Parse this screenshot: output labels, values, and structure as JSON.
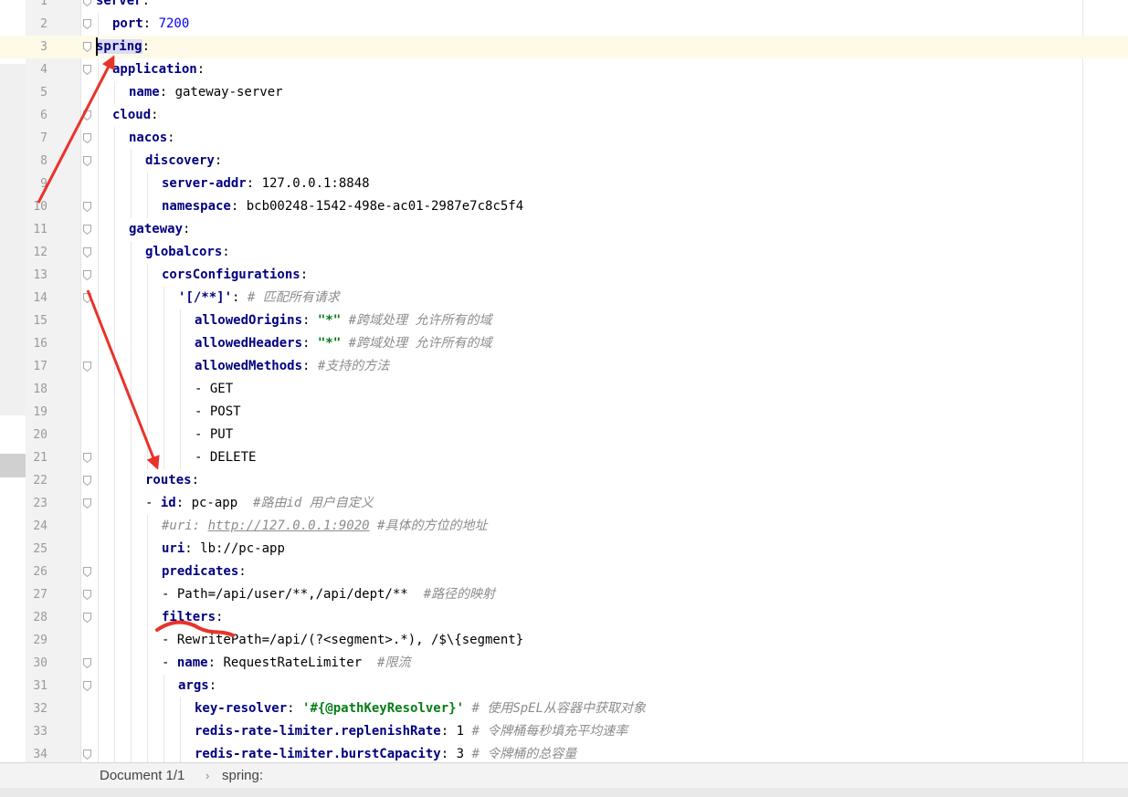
{
  "editor": {
    "current_line": 3,
    "lines": [
      {
        "n": 1,
        "fold": true,
        "indent": 0,
        "segs": [
          {
            "t": "server",
            "c": "k"
          },
          {
            "t": ":",
            "c": "p"
          }
        ]
      },
      {
        "n": 2,
        "fold": true,
        "indent": 1,
        "segs": [
          {
            "t": "port",
            "c": "k"
          },
          {
            "t": ": ",
            "c": "p"
          },
          {
            "t": "7200",
            "c": "n"
          }
        ]
      },
      {
        "n": 3,
        "fold": true,
        "indent": 0,
        "segs": [
          {
            "t": "spring",
            "c": "k hl"
          },
          {
            "t": ":",
            "c": "p"
          }
        ]
      },
      {
        "n": 4,
        "fold": true,
        "indent": 1,
        "segs": [
          {
            "t": "application",
            "c": "k"
          },
          {
            "t": ":",
            "c": "p"
          }
        ]
      },
      {
        "n": 5,
        "fold": false,
        "indent": 2,
        "segs": [
          {
            "t": "name",
            "c": "k"
          },
          {
            "t": ": ",
            "c": "p"
          },
          {
            "t": "gateway-server",
            "c": "v"
          }
        ]
      },
      {
        "n": 6,
        "fold": true,
        "indent": 1,
        "segs": [
          {
            "t": "cloud",
            "c": "k"
          },
          {
            "t": ":",
            "c": "p"
          }
        ]
      },
      {
        "n": 7,
        "fold": true,
        "indent": 2,
        "segs": [
          {
            "t": "nacos",
            "c": "k"
          },
          {
            "t": ":",
            "c": "p"
          }
        ]
      },
      {
        "n": 8,
        "fold": true,
        "indent": 3,
        "segs": [
          {
            "t": "discovery",
            "c": "k"
          },
          {
            "t": ":",
            "c": "p"
          }
        ]
      },
      {
        "n": 9,
        "fold": false,
        "indent": 4,
        "segs": [
          {
            "t": "server-addr",
            "c": "k"
          },
          {
            "t": ": ",
            "c": "p"
          },
          {
            "t": "127.0.0.1:8848",
            "c": "v"
          }
        ]
      },
      {
        "n": 10,
        "fold": true,
        "indent": 4,
        "segs": [
          {
            "t": "namespace",
            "c": "k"
          },
          {
            "t": ": ",
            "c": "p"
          },
          {
            "t": "bcb00248-1542-498e-ac01-2987e7c8c5f4",
            "c": "v"
          }
        ]
      },
      {
        "n": 11,
        "fold": true,
        "indent": 2,
        "segs": [
          {
            "t": "gateway",
            "c": "k"
          },
          {
            "t": ":",
            "c": "p"
          }
        ]
      },
      {
        "n": 12,
        "fold": true,
        "indent": 3,
        "segs": [
          {
            "t": "globalcors",
            "c": "k"
          },
          {
            "t": ":",
            "c": "p"
          }
        ]
      },
      {
        "n": 13,
        "fold": true,
        "indent": 4,
        "segs": [
          {
            "t": "corsConfigurations",
            "c": "k"
          },
          {
            "t": ":",
            "c": "p"
          }
        ]
      },
      {
        "n": 14,
        "fold": true,
        "indent": 5,
        "segs": [
          {
            "t": "'[/**]'",
            "c": "k"
          },
          {
            "t": ": ",
            "c": "p"
          },
          {
            "t": "# 匹配所有请求",
            "c": "c"
          }
        ]
      },
      {
        "n": 15,
        "fold": false,
        "indent": 6,
        "segs": [
          {
            "t": "allowedOrigins",
            "c": "k"
          },
          {
            "t": ": ",
            "c": "p"
          },
          {
            "t": "\"*\"",
            "c": "s"
          },
          {
            "t": " ",
            "c": "p"
          },
          {
            "t": "#跨域处理 允许所有的域",
            "c": "c"
          }
        ]
      },
      {
        "n": 16,
        "fold": false,
        "indent": 6,
        "segs": [
          {
            "t": "allowedHeaders",
            "c": "k"
          },
          {
            "t": ": ",
            "c": "p"
          },
          {
            "t": "\"*\"",
            "c": "s"
          },
          {
            "t": " ",
            "c": "p"
          },
          {
            "t": "#跨域处理 允许所有的域",
            "c": "c"
          }
        ]
      },
      {
        "n": 17,
        "fold": true,
        "indent": 6,
        "segs": [
          {
            "t": "allowedMethods",
            "c": "k"
          },
          {
            "t": ": ",
            "c": "p"
          },
          {
            "t": "#支持的方法",
            "c": "c"
          }
        ]
      },
      {
        "n": 18,
        "fold": false,
        "indent": 6,
        "segs": [
          {
            "t": "- GET",
            "c": "v"
          }
        ]
      },
      {
        "n": 19,
        "fold": false,
        "indent": 6,
        "segs": [
          {
            "t": "- POST",
            "c": "v"
          }
        ]
      },
      {
        "n": 20,
        "fold": false,
        "indent": 6,
        "segs": [
          {
            "t": "- PUT",
            "c": "v"
          }
        ]
      },
      {
        "n": 21,
        "fold": true,
        "indent": 6,
        "segs": [
          {
            "t": "- DELETE",
            "c": "v"
          }
        ]
      },
      {
        "n": 22,
        "fold": true,
        "indent": 3,
        "segs": [
          {
            "t": "routes",
            "c": "k"
          },
          {
            "t": ":",
            "c": "p"
          }
        ]
      },
      {
        "n": 23,
        "fold": true,
        "indent": 3,
        "segs": [
          {
            "t": "- ",
            "c": "v"
          },
          {
            "t": "id",
            "c": "k"
          },
          {
            "t": ": ",
            "c": "p"
          },
          {
            "t": "pc-app",
            "c": "v"
          },
          {
            "t": "  ",
            "c": "p"
          },
          {
            "t": "#路由id 用户自定义",
            "c": "c"
          }
        ]
      },
      {
        "n": 24,
        "fold": false,
        "indent": 4,
        "segs": [
          {
            "t": "#uri: ",
            "c": "c"
          },
          {
            "t": "http://127.0.0.1:9020",
            "c": "u"
          },
          {
            "t": " #具体的方位的地址",
            "c": "c"
          }
        ]
      },
      {
        "n": 25,
        "fold": false,
        "indent": 4,
        "segs": [
          {
            "t": "uri",
            "c": "k"
          },
          {
            "t": ": ",
            "c": "p"
          },
          {
            "t": "lb://pc-app",
            "c": "v"
          }
        ]
      },
      {
        "n": 26,
        "fold": true,
        "indent": 4,
        "segs": [
          {
            "t": "predicates",
            "c": "k"
          },
          {
            "t": ":",
            "c": "p"
          }
        ]
      },
      {
        "n": 27,
        "fold": true,
        "indent": 4,
        "segs": [
          {
            "t": "- Path=/api/user/**,/api/dept/**",
            "c": "v"
          },
          {
            "t": "  ",
            "c": "p"
          },
          {
            "t": "#路径的映射",
            "c": "c"
          }
        ]
      },
      {
        "n": 28,
        "fold": true,
        "indent": 4,
        "segs": [
          {
            "t": "filters",
            "c": "k"
          },
          {
            "t": ":",
            "c": "p"
          }
        ]
      },
      {
        "n": 29,
        "fold": false,
        "indent": 4,
        "segs": [
          {
            "t": "- RewritePath=/api/(?<segment>.*), /$\\{segment}",
            "c": "v"
          }
        ]
      },
      {
        "n": 30,
        "fold": true,
        "indent": 4,
        "segs": [
          {
            "t": "- ",
            "c": "v"
          },
          {
            "t": "name",
            "c": "k"
          },
          {
            "t": ": ",
            "c": "p"
          },
          {
            "t": "RequestRateLimiter",
            "c": "v"
          },
          {
            "t": "  ",
            "c": "p"
          },
          {
            "t": "#限流",
            "c": "c"
          }
        ]
      },
      {
        "n": 31,
        "fold": true,
        "indent": 5,
        "segs": [
          {
            "t": "args",
            "c": "k"
          },
          {
            "t": ":",
            "c": "p"
          }
        ]
      },
      {
        "n": 32,
        "fold": false,
        "indent": 6,
        "segs": [
          {
            "t": "key-resolver",
            "c": "k"
          },
          {
            "t": ": ",
            "c": "p"
          },
          {
            "t": "'#{@pathKeyResolver}'",
            "c": "s"
          },
          {
            "t": " ",
            "c": "p"
          },
          {
            "t": "# 使用SpEL从容器中获取对象",
            "c": "c"
          }
        ]
      },
      {
        "n": 33,
        "fold": false,
        "indent": 6,
        "segs": [
          {
            "t": "redis-rate-limiter.replenishRate",
            "c": "k"
          },
          {
            "t": ": ",
            "c": "p"
          },
          {
            "t": "1",
            "c": "v"
          },
          {
            "t": " ",
            "c": "p"
          },
          {
            "t": "# 令牌桶每秒填充平均速率",
            "c": "c"
          }
        ]
      },
      {
        "n": 34,
        "fold": true,
        "indent": 6,
        "segs": [
          {
            "t": "redis-rate-limiter.burstCapacity",
            "c": "k"
          },
          {
            "t": ": ",
            "c": "p"
          },
          {
            "t": "3",
            "c": "v"
          },
          {
            "t": " ",
            "c": "p"
          },
          {
            "t": "# 令牌桶的总容量",
            "c": "c"
          }
        ]
      }
    ]
  },
  "status": {
    "document": "Document 1/1",
    "separator": "›",
    "breadcrumb": "spring:"
  },
  "colors": {
    "keyword": "#000080",
    "string": "#067d17",
    "number": "#0000ff",
    "comment": "#8c8c8c",
    "annotation_red": "#e8332a"
  }
}
